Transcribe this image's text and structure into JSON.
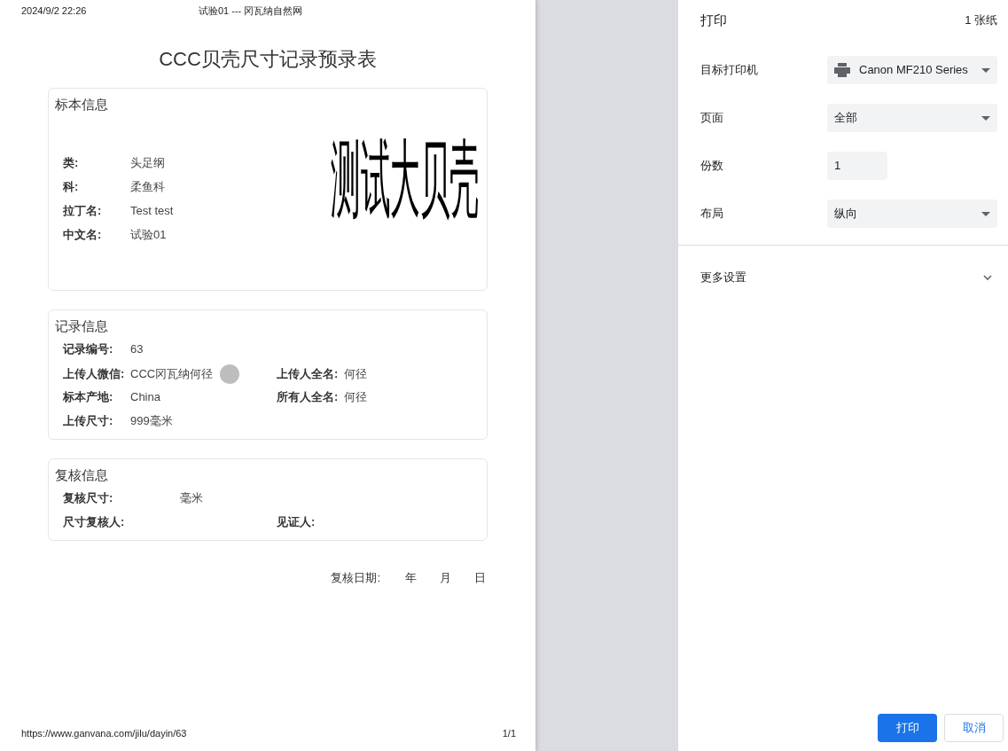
{
  "page_header": {
    "date": "2024/9/2 22:26",
    "title": "试验01 --- 冈瓦纳自然网"
  },
  "document": {
    "title": "CCC贝壳尺寸记录预录表",
    "sections": [
      {
        "kind": "specimen",
        "title": "标本信息",
        "rows": [
          [
            {
              "label": "类:",
              "value": "头足纲"
            }
          ],
          [
            {
              "label": "科:",
              "value": "柔鱼科"
            }
          ],
          [
            {
              "label": "拉丁名:",
              "value": "Test test"
            }
          ],
          [
            {
              "label": "中文名:",
              "value": "试验01"
            }
          ]
        ],
        "stamp": "测试大贝壳"
      },
      {
        "kind": "record",
        "title": "记录信息",
        "rows": [
          [
            {
              "label": "记录编号:",
              "value": "63"
            }
          ],
          [
            {
              "label": "上传人微信:",
              "value": "CCC冈瓦纳何径",
              "avatar": true
            },
            {
              "label": "上传人全名:",
              "value": "何径"
            }
          ],
          [
            {
              "label": "标本产地:",
              "value": "China"
            },
            {
              "label": "所有人全名:",
              "value": "何径"
            }
          ],
          [
            {
              "label": "上传尺寸:",
              "value": "999毫米"
            }
          ]
        ]
      },
      {
        "kind": "review",
        "title": "复核信息",
        "rows": [
          [
            {
              "label": "复核尺寸:",
              "value": "毫米"
            }
          ],
          [
            {
              "label": "尺寸复核人:"
            },
            {
              "label": "见证人:"
            }
          ]
        ]
      }
    ],
    "review_date": {
      "label": "复核日期:",
      "parts": [
        "年",
        "月",
        "日"
      ]
    }
  },
  "page_footer": {
    "url": "https://www.ganvana.com/jilu/dayin/63",
    "page": "1/1"
  },
  "print_panel": {
    "title": "打印",
    "sheets": "1 张纸",
    "settings": [
      {
        "kind": "select",
        "label": "目标打印机",
        "value": "Canon MF210 Series",
        "icon": true
      },
      {
        "kind": "select",
        "label": "页面",
        "value": "全部",
        "icon": false
      },
      {
        "kind": "number",
        "label": "份数",
        "value": "1"
      },
      {
        "kind": "select",
        "label": "布局",
        "value": "纵向",
        "icon": false
      }
    ],
    "more_settings": {
      "label": "更多设置",
      "expanded": false
    },
    "buttons": [
      {
        "kind": "primary",
        "label": "打印"
      },
      {
        "kind": "secondary",
        "label": "取消"
      }
    ]
  }
}
